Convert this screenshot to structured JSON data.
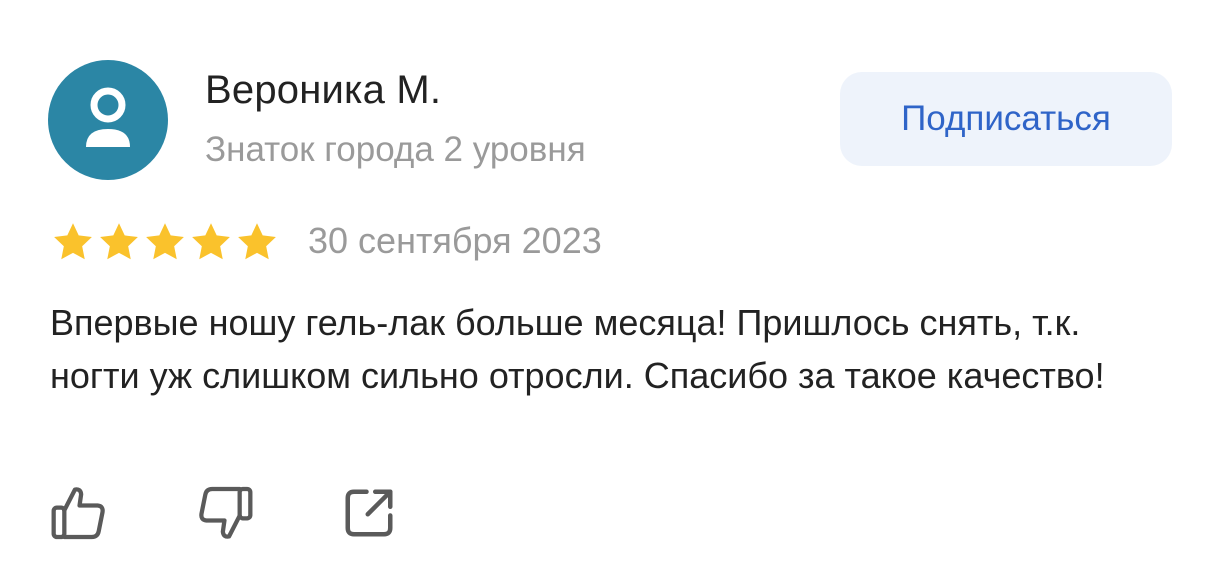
{
  "author": {
    "name": "Вероника М.",
    "level": "Знаток города 2 уровня",
    "avatar_icon": "user-silhouette-icon",
    "avatar_color": "#2b86a5"
  },
  "subscribe_button": {
    "label": "Подписаться"
  },
  "review": {
    "rating": 5,
    "rating_max": 5,
    "star_color": "#fac22c",
    "date": "30 сентября 2023",
    "text": "Впервые ношу гель-лак больше месяца! Пришлось снять, т.к. ногти уж слишком сильно отросли. Спасибо за такое качество!"
  },
  "actions": [
    {
      "name": "like",
      "icon": "thumbs-up-icon"
    },
    {
      "name": "dislike",
      "icon": "thumbs-down-icon"
    },
    {
      "name": "share",
      "icon": "share-icon"
    }
  ]
}
